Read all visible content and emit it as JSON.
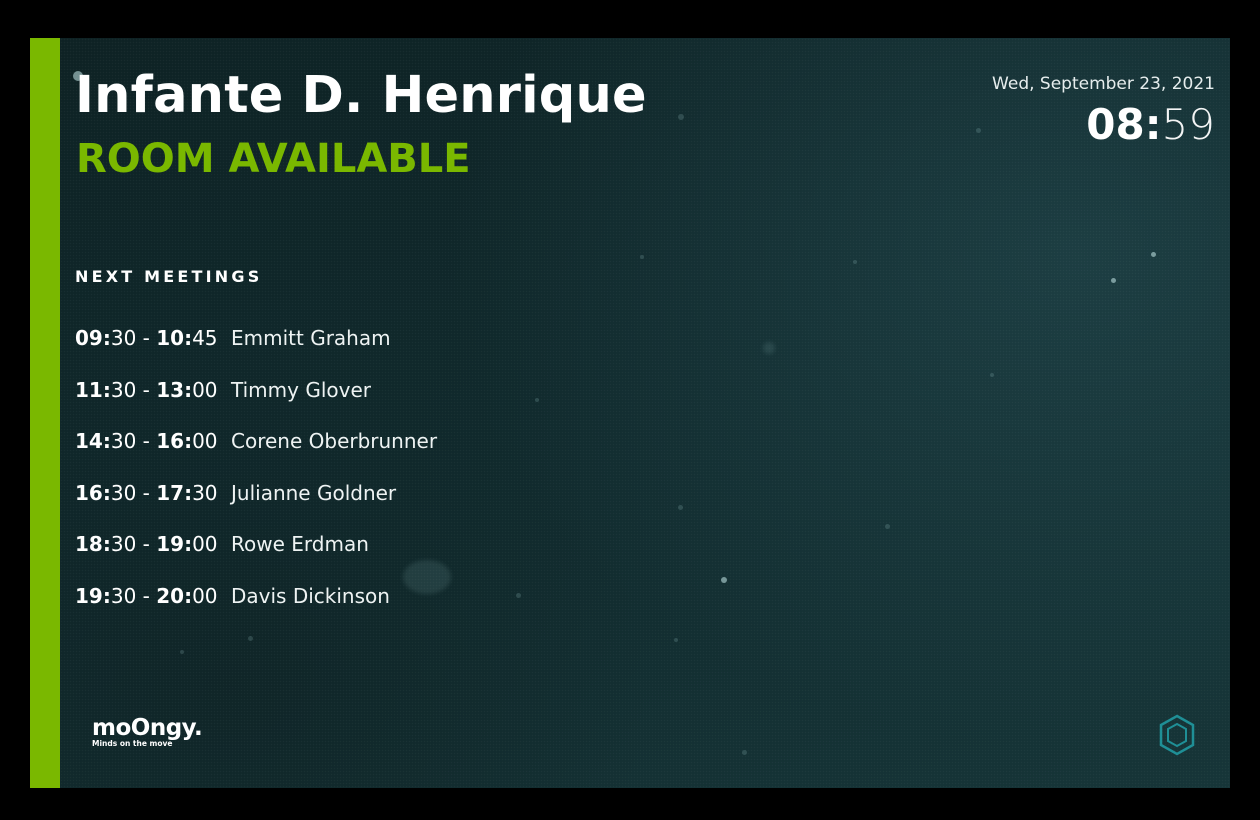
{
  "room": {
    "name": "Infante D. Henrique",
    "status": "ROOM AVAILABLE"
  },
  "clock": {
    "date": "Wed, September 23, 2021",
    "hours": "08:",
    "minutes": "59"
  },
  "agenda": {
    "heading": "NEXT MEETINGS",
    "meetings": [
      {
        "start_h": "09:",
        "start_m": "30",
        "end_h": "10:",
        "end_m": "45",
        "organizer": "Emmitt Graham"
      },
      {
        "start_h": "11:",
        "start_m": "30",
        "end_h": "13:",
        "end_m": "00",
        "organizer": "Timmy Glover"
      },
      {
        "start_h": "14:",
        "start_m": "30",
        "end_h": "16:",
        "end_m": "00",
        "organizer": "Corene Oberbrunner"
      },
      {
        "start_h": "16:",
        "start_m": "30",
        "end_h": "17:",
        "end_m": "30",
        "organizer": "Julianne Goldner"
      },
      {
        "start_h": "18:",
        "start_m": "30",
        "end_h": "19:",
        "end_m": "00",
        "organizer": "Rowe Erdman"
      },
      {
        "start_h": "19:",
        "start_m": "30",
        "end_h": "20:",
        "end_m": "00",
        "organizer": "Davis Dickinson"
      }
    ]
  },
  "logo": {
    "brand": "moOngy.",
    "tagline": "Minds on the move"
  },
  "colors": {
    "accent": "#7ab800",
    "background": "#10292c",
    "text": "#ffffff",
    "icon": "#1f8f96"
  },
  "icons": {
    "corner_icon": "hexagon-icon"
  }
}
